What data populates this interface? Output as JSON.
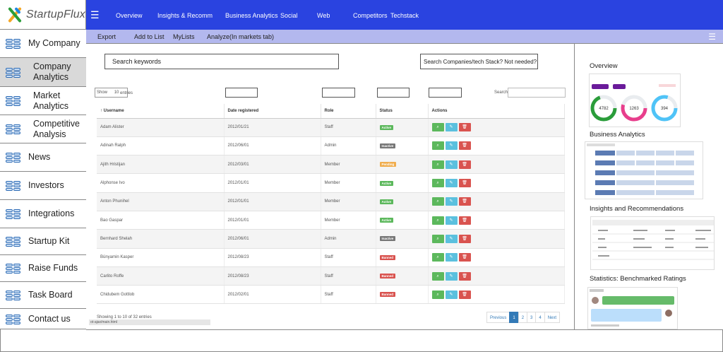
{
  "app": {
    "name": "StartupFlux"
  },
  "topnav": [
    "Overview",
    "Insights & Recomm",
    "Business Analytics",
    "Social",
    "Web",
    "Competitors",
    "Techstack"
  ],
  "subnav": [
    "Export",
    "Add to List",
    "MyLists",
    "Analyze(In markets tab)"
  ],
  "sidebar": {
    "items": [
      {
        "label": "My Company",
        "active": false
      },
      {
        "label": "Company Analytics",
        "active": true
      },
      {
        "label": "Market Analytics",
        "active": false
      },
      {
        "label": "Competitive Analysis",
        "active": false
      },
      {
        "label": "News",
        "active": false
      },
      {
        "label": "Investors",
        "active": false
      },
      {
        "label": "Integrations",
        "active": false
      },
      {
        "label": "Startup Kit",
        "active": false
      },
      {
        "label": "Raise Funds",
        "active": false
      },
      {
        "label": "Task Board",
        "active": false
      },
      {
        "label": "Contact us",
        "active": false
      }
    ]
  },
  "search": {
    "keywords_placeholder": "Search keywords",
    "companies_placeholder": "Search Companies/tech Stack? Not needed?"
  },
  "table": {
    "show_label": "Show",
    "show_value": "10",
    "entries_label": "entries",
    "search_label": "Search:",
    "columns": [
      "↑ Username",
      "Date registered",
      "Role",
      "Status",
      "Actions"
    ],
    "rows": [
      {
        "username": "Adam Alister",
        "date": "2012/01/21",
        "role": "Staff",
        "status": "Active"
      },
      {
        "username": "Adinah Ralph",
        "date": "2012/06/01",
        "role": "Admin",
        "status": "Inactive"
      },
      {
        "username": "Ajith Hristijan",
        "date": "2012/03/01",
        "role": "Member",
        "status": "Pending"
      },
      {
        "username": "Alphonse Ivo",
        "date": "2012/01/01",
        "role": "Member",
        "status": "Active"
      },
      {
        "username": "Anton Phunihel",
        "date": "2012/01/01",
        "role": "Member",
        "status": "Active"
      },
      {
        "username": "Bao Gaspar",
        "date": "2012/01/01",
        "role": "Member",
        "status": "Active"
      },
      {
        "username": "Bernhard Shelah",
        "date": "2012/06/01",
        "role": "Admin",
        "status": "Inactive"
      },
      {
        "username": "Bünyamin Kasper",
        "date": "2012/08/23",
        "role": "Staff",
        "status": "Banned"
      },
      {
        "username": "Carlito Roffe",
        "date": "2012/08/23",
        "role": "Staff",
        "status": "Banned"
      },
      {
        "username": "Chidubem Gottlob",
        "date": "2012/02/01",
        "role": "Staff",
        "status": "Banned"
      }
    ],
    "info": "Showing 1 to 10 of 32 entries",
    "url": "ot-ajax/main.html"
  },
  "pager": {
    "prev": "Previous",
    "pages": [
      "1",
      "2",
      "3",
      "4"
    ],
    "next": "Next",
    "current": "1"
  },
  "status_colors": {
    "Active": "#5cb85c",
    "Inactive": "#777777",
    "Pending": "#f0ad4e",
    "Banned": "#d9534f"
  },
  "right_panel": {
    "overview_title": "Overview",
    "overview_stats": [
      "4782",
      "1263",
      "394"
    ],
    "business_title": "Business Analytics",
    "insights_title": "Insights and Recommendations",
    "statistics_title": "Statistics: Benchmarked Ratings"
  },
  "colors": {
    "topbar": "#2a43e0",
    "subbar": "#b3b8ee"
  }
}
